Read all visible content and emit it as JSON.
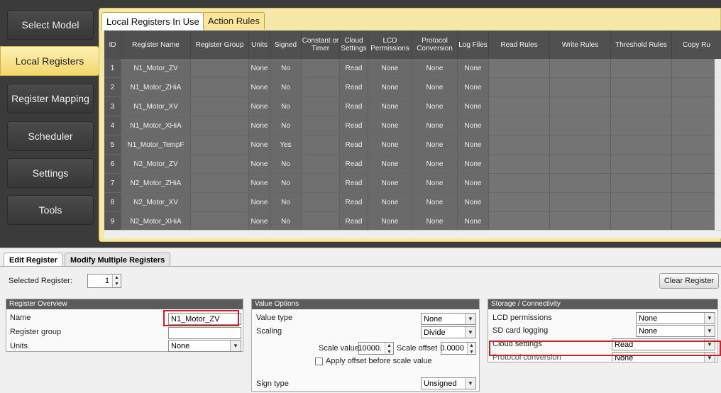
{
  "sidebar": {
    "items": [
      {
        "label": "Select Model"
      },
      {
        "label": "Local Registers"
      },
      {
        "label": "Register Mapping"
      },
      {
        "label": "Scheduler"
      },
      {
        "label": "Settings"
      },
      {
        "label": "Tools"
      }
    ],
    "active": "Local Registers"
  },
  "top_tabs": {
    "local": "Local Registers In Use",
    "action": "Action Rules"
  },
  "table": {
    "headers": [
      "ID",
      "Register Name",
      "Register Group",
      "Units",
      "Signed",
      "Constant or Timer",
      "Cloud Settings",
      "LCD Permissions",
      "Protocol Conversion",
      "Log Files",
      "Read Rules",
      "Write Rules",
      "Threshold Rules",
      "Copy Ru"
    ],
    "rows": [
      {
        "id": "1",
        "name": "N1_Motor_ZV",
        "group": "",
        "units": "None",
        "signed": "No",
        "const": "",
        "cloud": "Read",
        "lcd": "None",
        "protocol": "None",
        "log": "None"
      },
      {
        "id": "2",
        "name": "N1_Motor_ZHiA",
        "group": "",
        "units": "None",
        "signed": "No",
        "const": "",
        "cloud": "Read",
        "lcd": "None",
        "protocol": "None",
        "log": "None"
      },
      {
        "id": "3",
        "name": "N1_Motor_XV",
        "group": "",
        "units": "None",
        "signed": "No",
        "const": "",
        "cloud": "Read",
        "lcd": "None",
        "protocol": "None",
        "log": "None"
      },
      {
        "id": "4",
        "name": "N1_Motor_XHiA",
        "group": "",
        "units": "None",
        "signed": "No",
        "const": "",
        "cloud": "Read",
        "lcd": "None",
        "protocol": "None",
        "log": "None"
      },
      {
        "id": "5",
        "name": "N1_Motor_TempF",
        "group": "",
        "units": "None",
        "signed": "Yes",
        "const": "",
        "cloud": "Read",
        "lcd": "None",
        "protocol": "None",
        "log": "None"
      },
      {
        "id": "6",
        "name": "N2_Motor_ZV",
        "group": "",
        "units": "None",
        "signed": "No",
        "const": "",
        "cloud": "Read",
        "lcd": "None",
        "protocol": "None",
        "log": "None"
      },
      {
        "id": "7",
        "name": "N2_Motor_ZHiA",
        "group": "",
        "units": "None",
        "signed": "No",
        "const": "",
        "cloud": "Read",
        "lcd": "None",
        "protocol": "None",
        "log": "None"
      },
      {
        "id": "8",
        "name": "N2_Motor_XV",
        "group": "",
        "units": "None",
        "signed": "No",
        "const": "",
        "cloud": "Read",
        "lcd": "None",
        "protocol": "None",
        "log": "None"
      },
      {
        "id": "9",
        "name": "N2_Motor_XHiA",
        "group": "",
        "units": "None",
        "signed": "No",
        "const": "",
        "cloud": "Read",
        "lcd": "None",
        "protocol": "None",
        "log": "None"
      }
    ]
  },
  "bottom_tabs": {
    "edit": "Edit Register",
    "modify": "Modify Multiple Registers"
  },
  "selected_register": {
    "label": "Selected Register:",
    "value": "1"
  },
  "clear_button": "Clear Register",
  "overview": {
    "title": "Register Overview",
    "name_label": "Name",
    "name_value": "N1_Motor_ZV",
    "group_label": "Register group",
    "group_value": "",
    "units_label": "Units",
    "units_value": "None"
  },
  "value_options": {
    "title": "Value Options",
    "value_type_label": "Value type",
    "value_type": "None",
    "scaling_label": "Scaling",
    "scaling": "Divide",
    "scale_value_label": "Scale value",
    "scale_value": "10000.",
    "scale_offset_label": "Scale offset",
    "scale_offset": "0.0000",
    "apply_offset_label": "Apply offset before scale value",
    "sign_type_label": "Sign type",
    "sign_type": "Unsigned"
  },
  "storage": {
    "title": "Storage / Connectivity",
    "lcd_label": "LCD permissions",
    "lcd_value": "None",
    "sd_label": "SD card logging",
    "sd_value": "None",
    "cloud_label": "Cloud settings",
    "cloud_value": "Read",
    "protocol_label": "Protocol conversion",
    "protocol_value": "None"
  },
  "colors": {
    "active_tab_yellow": "#f3d66a",
    "highlight_red": "#d02027",
    "grid_gray": "#676767"
  }
}
